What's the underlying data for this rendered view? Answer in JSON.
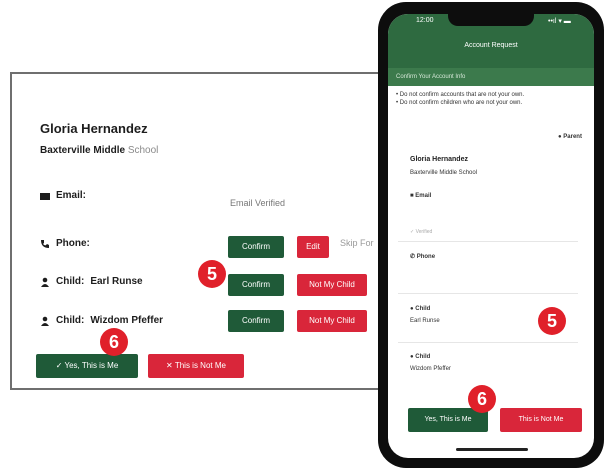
{
  "desktop": {
    "name": "Gloria Hernandez",
    "school_main": "Baxterville Middle",
    "school_rest": "School",
    "email_label": "Email:",
    "email_status": "Email Verified",
    "phone_label": "Phone:",
    "confirm": "Confirm",
    "edit": "Edit",
    "skip": "Skip For",
    "child_label": "Child:",
    "child1": "Earl Runse",
    "child2": "Wizdom Pfeffer",
    "not_my_child": "Not My Child",
    "yes_this_is_me": "✓ Yes, This is Me",
    "this_is_not_me": "✕ This is Not Me"
  },
  "badges": {
    "five": "5",
    "six": "6"
  },
  "phone": {
    "time": "12:00",
    "status": "••ıl ▾ ▬",
    "title": "Account Request",
    "subheader": "Confirm Your Account Info",
    "note1": "• Do not confirm accounts that are not your own.",
    "note2": "• Do not confirm children who are not your own.",
    "parent": "Parent",
    "name": "Gloria Hernandez",
    "school": "Baxterville Middle School",
    "email": "Email",
    "verified": "✓ Verified",
    "phone_label": "Phone",
    "child_label": "Child",
    "child1": "Earl Runse",
    "child2": "Wizdom Pfeffer",
    "yes": "Yes, This is Me",
    "no": "This is Not Me"
  },
  "colors": {
    "green": "#1f5a38",
    "red": "#d9263a",
    "badge": "#e0202a"
  }
}
